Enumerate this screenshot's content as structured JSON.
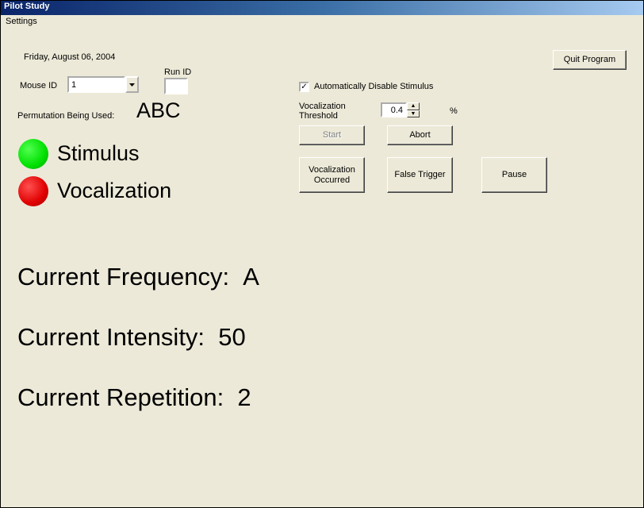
{
  "window": {
    "title": "Pilot Study"
  },
  "menu": {
    "settings": "Settings"
  },
  "header": {
    "date": "Friday, August 06, 2004",
    "mouse_id_label": "Mouse ID",
    "mouse_id_value": "1",
    "run_id_label": "Run ID",
    "run_id_value": "",
    "perm_label": "Permutation Being Used:",
    "perm_value": "ABC"
  },
  "controls": {
    "quit": "Quit Program",
    "auto_disable": "Automatically Disable Stimulus",
    "auto_disable_checked": "✓",
    "voc_thresh_label": "Vocalization\nThreshold",
    "voc_thresh_value": "0.4",
    "percent": "%",
    "start": "Start",
    "abort": "Abort",
    "voc_occurred": "Vocalization\nOccurred",
    "false_trigger": "False Trigger",
    "pause": "Pause"
  },
  "indicators": {
    "stimulus": "Stimulus",
    "vocalization": "Vocalization"
  },
  "status": {
    "freq_label": "Current Frequency:",
    "freq_value": "A",
    "intensity_label": "Current Intensity:",
    "intensity_value": "50",
    "rep_label": "Current Repetition:",
    "rep_value": "2"
  }
}
